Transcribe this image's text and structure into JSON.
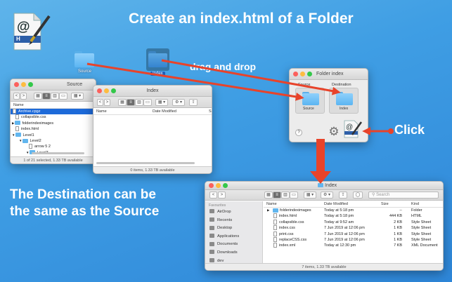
{
  "headline": "Create an index.html of a Folder",
  "drag_label": "drag and drop",
  "click_label": "Click",
  "subtitle_line1": "The Destination can be",
  "subtitle_line2": "the same as the Source",
  "app_icon": {
    "icon": "html-document-with-pen-icon",
    "partial_text": "@",
    "partial_label": "H"
  },
  "desktop_folders": [
    {
      "label": "Source",
      "icon": "folder-icon"
    },
    {
      "label": "Index",
      "icon": "folder-icon"
    }
  ],
  "source_window": {
    "title": "Source",
    "column_name": "Name",
    "rows": [
      {
        "indent": 0,
        "label": "Archive.cpgz",
        "kind": "file",
        "selected": true
      },
      {
        "indent": 0,
        "label": "collapsible.css",
        "kind": "file"
      },
      {
        "indent": 0,
        "label": "folderindeximages",
        "kind": "folder",
        "disclosure": "▶"
      },
      {
        "indent": 0,
        "label": "index.html",
        "kind": "file"
      },
      {
        "indent": 0,
        "label": "Level1",
        "kind": "folder",
        "disclosure": "▼"
      },
      {
        "indent": 1,
        "label": "Level2",
        "kind": "folder",
        "disclosure": "▼"
      },
      {
        "indent": 2,
        "label": "arrow 5 2",
        "kind": "file"
      },
      {
        "indent": 2,
        "label": "Level3",
        "kind": "folder",
        "disclosure": "▼"
      }
    ],
    "status": "1 of 21 selected, 1.33 TB available"
  },
  "index_window": {
    "title": "Index",
    "columns": [
      "Name",
      "Date Modified",
      "Si"
    ],
    "status": "0 items, 1.33 TB available"
  },
  "app_window": {
    "title": "Folder index",
    "source_label": "Source",
    "destination_label": "Destination",
    "source_folder_label": "Source",
    "dest_folder_label": "Index",
    "help": "?",
    "gear_icon": "gear-icon",
    "run_icon": "html-pen-icon"
  },
  "result_window": {
    "title": "Index",
    "search_placeholder": "Search",
    "sidebar_header": "Favourites",
    "sidebar": [
      {
        "label": "AirDrop",
        "icon": "airdrop-icon"
      },
      {
        "label": "Recents",
        "icon": "recents-icon"
      },
      {
        "label": "Desktop",
        "icon": "desktop-icon"
      },
      {
        "label": "Applications",
        "icon": "applications-icon"
      },
      {
        "label": "Documents",
        "icon": "documents-icon"
      },
      {
        "label": "Downloads",
        "icon": "downloads-icon"
      },
      {
        "label": "dev",
        "icon": "home-icon"
      }
    ],
    "columns": [
      "Name",
      "Date Modified",
      "Size",
      "Kind"
    ],
    "rows": [
      {
        "name": "folderindeximages",
        "date": "Today at 5:18 pm",
        "size": "--",
        "kind": "Folder",
        "type": "folder",
        "disclosure": "▶"
      },
      {
        "name": "index.html",
        "date": "Today at 5:18 pm",
        "size": "444 KB",
        "kind": "HTML",
        "type": "file"
      },
      {
        "name": "collapsible.css",
        "date": "Today at 9:52 am",
        "size": "2 KB",
        "kind": "Style Sheet",
        "type": "file"
      },
      {
        "name": "index.css",
        "date": "7 Jun 2019 at 12:06 pm",
        "size": "1 KB",
        "kind": "Style Sheet",
        "type": "file"
      },
      {
        "name": "print.css",
        "date": "7 Jun 2019 at 12:06 pm",
        "size": "1 KB",
        "kind": "Style Sheet",
        "type": "file"
      },
      {
        "name": "replaceCSS.css",
        "date": "7 Jun 2019 at 12:06 pm",
        "size": "1 KB",
        "kind": "Style Sheet",
        "type": "file"
      },
      {
        "name": "index.xml",
        "date": "Today at 12:30 pm",
        "size": "7 KB",
        "kind": "XML Document",
        "type": "file"
      }
    ],
    "status": "7 items, 1.33 TB available"
  },
  "colors": {
    "arrow": "#e8432a",
    "selection": "#1d6ad9",
    "folder": "#62b6ee"
  }
}
